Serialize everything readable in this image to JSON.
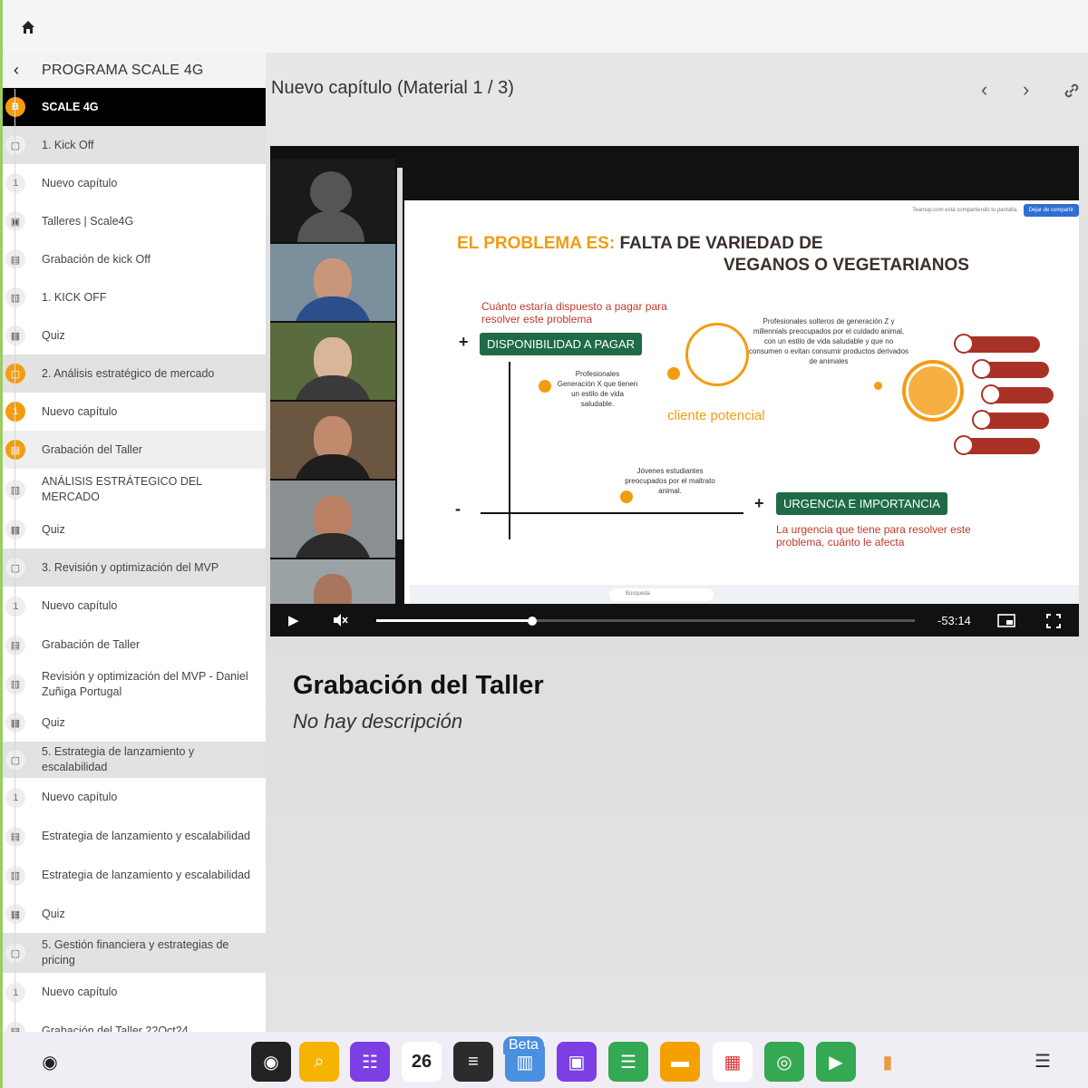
{
  "sidebar": {
    "back_icon": "chevron-left-icon",
    "title": "PROGRAMA SCALE 4G",
    "items": [
      {
        "label": "SCALE 4G",
        "badge": "B",
        "kind": "active"
      },
      {
        "label": "1. Kick Off",
        "badge": "▢",
        "kind": "mod"
      },
      {
        "label": "Nuevo capítulo",
        "badge": "1",
        "kind": "item"
      },
      {
        "label": "Talleres | Scale4G",
        "badge": "▣",
        "kind": "item"
      },
      {
        "label": "Grabación de kick Off",
        "badge": "▤",
        "kind": "item"
      },
      {
        "label": "1. KICK OFF",
        "badge": "▥",
        "kind": "item"
      },
      {
        "label": "Quiz",
        "badge": "▦",
        "kind": "item"
      },
      {
        "label": "2. Análisis estratégico de mercado",
        "badge": "▢",
        "kind": "mod-orange"
      },
      {
        "label": "Nuevo capítulo",
        "badge": "1",
        "kind": "item-orange"
      },
      {
        "label": "Grabación del Taller",
        "badge": "▤",
        "kind": "sel-orange"
      },
      {
        "label": "ANÁLISIS ESTRÁTEGICO DEL MERCADO",
        "badge": "▥",
        "kind": "item"
      },
      {
        "label": "Quiz",
        "badge": "▦",
        "kind": "item"
      },
      {
        "label": "3. Revisión y optimización del MVP",
        "badge": "▢",
        "kind": "mod"
      },
      {
        "label": "Nuevo capítulo",
        "badge": "1",
        "kind": "item"
      },
      {
        "label": "Grabación de Taller",
        "badge": "▤",
        "kind": "item"
      },
      {
        "label": "Revisión y optimización del MVP - Daniel Zuñiga Portugal",
        "badge": "▥",
        "kind": "item"
      },
      {
        "label": "Quiz",
        "badge": "▦",
        "kind": "item"
      },
      {
        "label": "5. Estrategia de lanzamiento y escalabilidad",
        "badge": "▢",
        "kind": "mod"
      },
      {
        "label": "Nuevo capítulo",
        "badge": "1",
        "kind": "item"
      },
      {
        "label": "Estrategia de lanzamiento y escalabilidad",
        "badge": "▤",
        "kind": "item"
      },
      {
        "label": "Estrategia de lanzamiento y escalabilidad",
        "badge": "▥",
        "kind": "item"
      },
      {
        "label": "Quiz",
        "badge": "▦",
        "kind": "item"
      },
      {
        "label": "5. Gestión financiera y estrategias de pricing",
        "badge": "▢",
        "kind": "mod"
      },
      {
        "label": "Nuevo capítulo",
        "badge": "1",
        "kind": "item"
      },
      {
        "label": "Grabación del Taller 22Oct24",
        "badge": "▤",
        "kind": "item"
      }
    ]
  },
  "header": {
    "title": "Nuevo capítulo (Material 1 / 3)",
    "prev_icon": "chevron-left-icon",
    "next_icon": "chevron-right-icon",
    "link_icon": "link-icon"
  },
  "video": {
    "slide": {
      "title_orange": "EL PROBLEMA ES:",
      "title_dark_1": "FALTA DE VARIEDAD DE",
      "title_dark_2": "VEGANOS O VEGETARIANOS",
      "question": "Cuánto estaría dispuesto a pagar para resolver este problema",
      "pill_pay": "DISPONIBILIDAD A PAGAR",
      "pill_urgency": "URGENCIA E IMPORTANCIA",
      "urgency_text": "La urgencia que tiene para resolver este problema, cuánto le afecta",
      "gen_x": "Profesionales Generación X que tienen un estilo de vida saludable.",
      "young": "Jóvenes estudiantes preocupados por el maltrato animal.",
      "gen_z": "Profesionales solteros de generación Z y millennials preocupados por el cuidado animal, con un estilo de vida saludable y que no consumen o evitan consumir productos derivados de animales",
      "target_label": "cliente potencial",
      "plus": "+",
      "minus": "-",
      "share_notice": "Teamup.com está compartiendo tu pantalla.",
      "share_stop": "Dejar de compartir",
      "taskbar_search": "Búsqueda"
    },
    "time_remaining": "-53:14",
    "progress": 0.29
  },
  "lesson": {
    "title": "Grabación del Taller",
    "description": "No hay descripción"
  },
  "dock": {
    "beta_label": "Beta",
    "calendar_day": "26",
    "menu_icon": "menu-icon"
  }
}
